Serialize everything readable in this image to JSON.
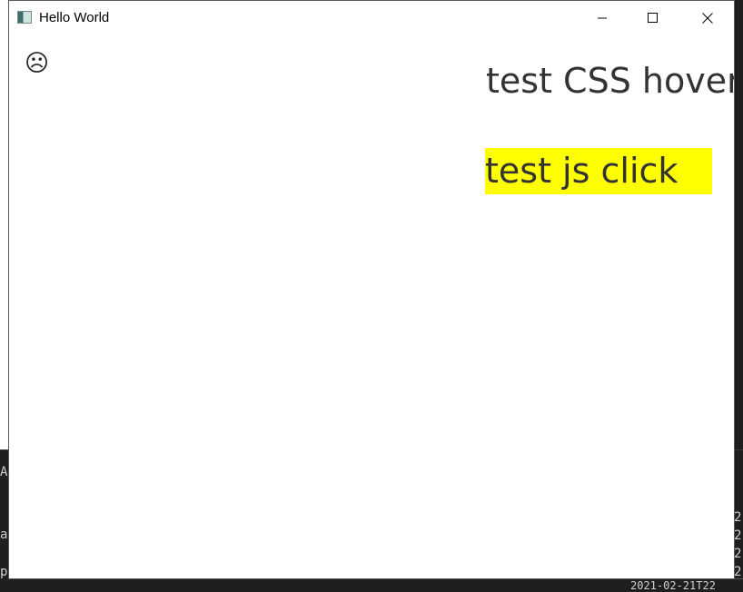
{
  "window": {
    "title": "Hello World",
    "controls": {
      "minimize": "minimize",
      "maximize": "maximize",
      "close": "close"
    }
  },
  "content": {
    "emoji": "☹",
    "hover_label": "test CSS hover",
    "click_label": "test js click",
    "click_bg_color": "#ffff00"
  },
  "background": {
    "left_chars": [
      "A",
      "a",
      "p"
    ],
    "right_chars": [
      "2",
      "2",
      "2",
      "2"
    ],
    "bottom_text": "2021-02-21T22"
  }
}
